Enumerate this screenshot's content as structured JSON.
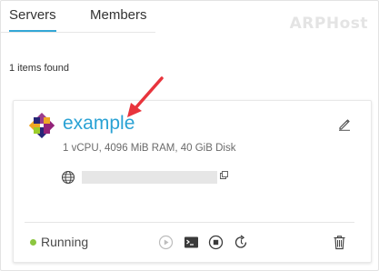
{
  "tabs": {
    "servers_label": "Servers",
    "members_label": "Members",
    "active": "Servers"
  },
  "watermark": "ARPHost",
  "results": {
    "count_text": "1 items found"
  },
  "server": {
    "name": "example",
    "specs": "1 vCPU, 4096 MiB RAM, 40 GiB Disk",
    "ip_address": "",
    "status": "Running",
    "status_color": "#8cc63f"
  },
  "actions": {
    "icons": [
      "start-icon",
      "console-icon",
      "stop-icon",
      "restart-icon",
      "delete-icon"
    ]
  },
  "colors": {
    "accent": "#2aa2d4",
    "annotation_arrow": "#e8343c"
  }
}
